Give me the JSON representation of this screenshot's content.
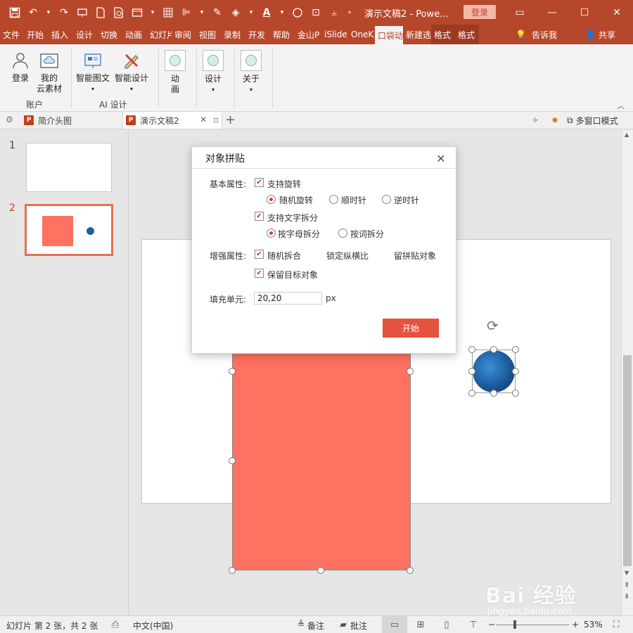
{
  "window": {
    "title": "演示文稿2  -  Powe...",
    "login_label": "登录"
  },
  "ribbon_tabs": [
    "文件",
    "开始",
    "插入",
    "设计",
    "切换",
    "动画",
    "幻灯片",
    "审阅",
    "视图",
    "录制",
    "开发",
    "帮助",
    "金山P",
    "iSlide",
    "OneK",
    "口袋动",
    "新建选",
    "格式",
    "格式"
  ],
  "ribbon_right": {
    "tell_me": "告诉我",
    "share": "共享"
  },
  "ribbon": {
    "login": "登录",
    "cloud_line1": "我的",
    "cloud_line2": "云素材",
    "account_group": "账户",
    "smart_graphic": "智能图文",
    "smart_design": "智能设计",
    "ai_group": "AI 设计",
    "anim_line1": "动",
    "anim_line2": "画",
    "design": "设计",
    "about": "关于"
  },
  "doc_tabs": [
    {
      "label": "简介头图"
    },
    {
      "label": "演示文稿2"
    }
  ],
  "doc_tabs_right": {
    "multi_window": "多窗口模式"
  },
  "thumbnails": [
    {
      "number": "1"
    },
    {
      "number": "2"
    }
  ],
  "dialog": {
    "title": "对象拼贴",
    "basic_label": "基本属性:",
    "support_rotate": "支持旋转",
    "random_rotate": "随机旋转",
    "clockwise": "顺时针",
    "counter_clockwise": "逆时针",
    "support_text_split": "支持文字拆分",
    "split_by_letter": "按字母拆分",
    "split_by_word": "按词拆分",
    "enhance_label": "增强属性:",
    "random_combine": "随机拆合",
    "lock_ratio": "锁定纵横比",
    "keep_tile": "留拼贴对象",
    "keep_target": "保留目标对象",
    "fill_label": "填充单元:",
    "fill_value": "20,20",
    "fill_unit": "px",
    "start": "开始"
  },
  "status": {
    "slide_info": "幻灯片 第 2 张，共 2 张",
    "language": "中文(中国)",
    "notes": "备注",
    "comments": "批注",
    "zoom": "53%"
  },
  "colors": {
    "brand": "#b7472a",
    "shape_fill": "#ff7161",
    "start_button": "#e5533f"
  },
  "watermark": {
    "main": "Bai 经验",
    "sub": "jingyan.baidu.com"
  }
}
